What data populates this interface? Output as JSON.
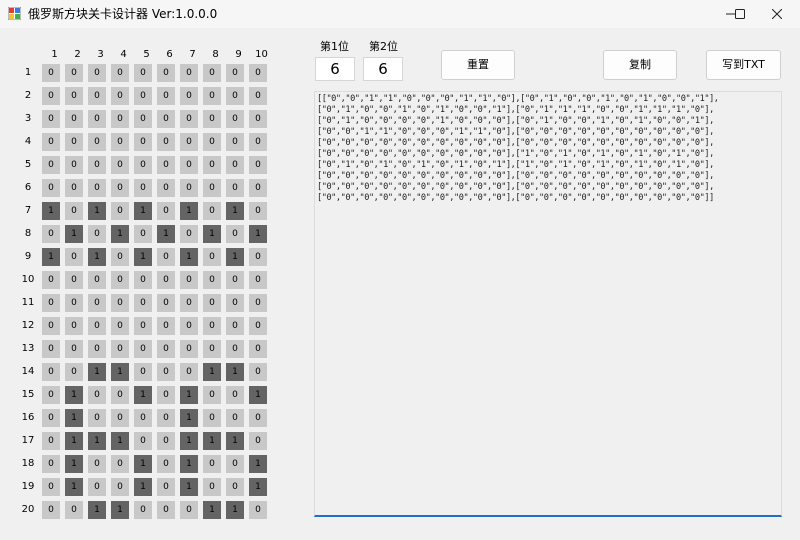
{
  "window": {
    "title": "俄罗斯方块关卡设计器 Ver:1.0.0.0"
  },
  "grid": {
    "col_headers": [
      "1",
      "2",
      "3",
      "4",
      "5",
      "6",
      "7",
      "8",
      "9",
      "10"
    ],
    "row_headers": [
      "1",
      "2",
      "3",
      "4",
      "5",
      "6",
      "7",
      "8",
      "9",
      "10",
      "11",
      "12",
      "13",
      "14",
      "15",
      "16",
      "17",
      "18",
      "19",
      "20"
    ],
    "rows": [
      [
        "0",
        "0",
        "0",
        "0",
        "0",
        "0",
        "0",
        "0",
        "0",
        "0"
      ],
      [
        "0",
        "0",
        "0",
        "0",
        "0",
        "0",
        "0",
        "0",
        "0",
        "0"
      ],
      [
        "0",
        "0",
        "0",
        "0",
        "0",
        "0",
        "0",
        "0",
        "0",
        "0"
      ],
      [
        "0",
        "0",
        "0",
        "0",
        "0",
        "0",
        "0",
        "0",
        "0",
        "0"
      ],
      [
        "0",
        "0",
        "0",
        "0",
        "0",
        "0",
        "0",
        "0",
        "0",
        "0"
      ],
      [
        "0",
        "0",
        "0",
        "0",
        "0",
        "0",
        "0",
        "0",
        "0",
        "0"
      ],
      [
        "1",
        "0",
        "1",
        "0",
        "1",
        "0",
        "1",
        "0",
        "1",
        "0"
      ],
      [
        "0",
        "1",
        "0",
        "1",
        "0",
        "1",
        "0",
        "1",
        "0",
        "1"
      ],
      [
        "1",
        "0",
        "1",
        "0",
        "1",
        "0",
        "1",
        "0",
        "1",
        "0"
      ],
      [
        "0",
        "0",
        "0",
        "0",
        "0",
        "0",
        "0",
        "0",
        "0",
        "0"
      ],
      [
        "0",
        "0",
        "0",
        "0",
        "0",
        "0",
        "0",
        "0",
        "0",
        "0"
      ],
      [
        "0",
        "0",
        "0",
        "0",
        "0",
        "0",
        "0",
        "0",
        "0",
        "0"
      ],
      [
        "0",
        "0",
        "0",
        "0",
        "0",
        "0",
        "0",
        "0",
        "0",
        "0"
      ],
      [
        "0",
        "0",
        "1",
        "1",
        "0",
        "0",
        "0",
        "1",
        "1",
        "0"
      ],
      [
        "0",
        "1",
        "0",
        "0",
        "1",
        "0",
        "1",
        "0",
        "0",
        "1"
      ],
      [
        "0",
        "1",
        "0",
        "0",
        "0",
        "0",
        "1",
        "0",
        "0",
        "0"
      ],
      [
        "0",
        "1",
        "1",
        "1",
        "0",
        "0",
        "1",
        "1",
        "1",
        "0"
      ],
      [
        "0",
        "1",
        "0",
        "0",
        "1",
        "0",
        "1",
        "0",
        "0",
        "1"
      ],
      [
        "0",
        "1",
        "0",
        "0",
        "1",
        "0",
        "1",
        "0",
        "0",
        "1"
      ],
      [
        "0",
        "0",
        "1",
        "1",
        "0",
        "0",
        "0",
        "1",
        "1",
        "0"
      ]
    ]
  },
  "digit1": {
    "label": "第1位",
    "value": "6"
  },
  "digit2": {
    "label": "第2位",
    "value": "6"
  },
  "buttons": {
    "reset": "重置",
    "copy": "复制",
    "write_txt": "写到TXT"
  },
  "output": {
    "text": "[[\"0\",\"0\",\"1\",\"1\",\"0\",\"0\",\"0\",\"1\",\"1\",\"0\"],[\"0\",\"1\",\"0\",\"0\",\"1\",\"0\",\"1\",\"0\",\"0\",\"1\"],\n[\"0\",\"1\",\"0\",\"0\",\"1\",\"0\",\"1\",\"0\",\"0\",\"1\"],[\"0\",\"1\",\"1\",\"1\",\"0\",\"0\",\"1\",\"1\",\"1\",\"0\"],\n[\"0\",\"1\",\"0\",\"0\",\"0\",\"0\",\"1\",\"0\",\"0\",\"0\"],[\"0\",\"1\",\"0\",\"0\",\"1\",\"0\",\"1\",\"0\",\"0\",\"1\"],\n[\"0\",\"0\",\"1\",\"1\",\"0\",\"0\",\"0\",\"1\",\"1\",\"0\"],[\"0\",\"0\",\"0\",\"0\",\"0\",\"0\",\"0\",\"0\",\"0\",\"0\"],\n[\"0\",\"0\",\"0\",\"0\",\"0\",\"0\",\"0\",\"0\",\"0\",\"0\"],[\"0\",\"0\",\"0\",\"0\",\"0\",\"0\",\"0\",\"0\",\"0\",\"0\"],\n[\"0\",\"0\",\"0\",\"0\",\"0\",\"0\",\"0\",\"0\",\"0\",\"0\"],[\"1\",\"0\",\"1\",\"0\",\"1\",\"0\",\"1\",\"0\",\"1\",\"0\"],\n[\"0\",\"1\",\"0\",\"1\",\"0\",\"1\",\"0\",\"1\",\"0\",\"1\"],[\"1\",\"0\",\"1\",\"0\",\"1\",\"0\",\"1\",\"0\",\"1\",\"0\"],\n[\"0\",\"0\",\"0\",\"0\",\"0\",\"0\",\"0\",\"0\",\"0\",\"0\"],[\"0\",\"0\",\"0\",\"0\",\"0\",\"0\",\"0\",\"0\",\"0\",\"0\"],\n[\"0\",\"0\",\"0\",\"0\",\"0\",\"0\",\"0\",\"0\",\"0\",\"0\"],[\"0\",\"0\",\"0\",\"0\",\"0\",\"0\",\"0\",\"0\",\"0\",\"0\"],\n[\"0\",\"0\",\"0\",\"0\",\"0\",\"0\",\"0\",\"0\",\"0\",\"0\"],[\"0\",\"0\",\"0\",\"0\",\"0\",\"0\",\"0\",\"0\",\"0\",\"0\"]]"
  },
  "colors": {
    "cell_off": "#c8c8c8",
    "cell_on": "#646464",
    "focus_underline": "#1f6fc6"
  },
  "icons": {
    "app": "app-icon",
    "minimize": "minimize-icon",
    "maximize": "maximize-icon",
    "close": "close-icon"
  }
}
